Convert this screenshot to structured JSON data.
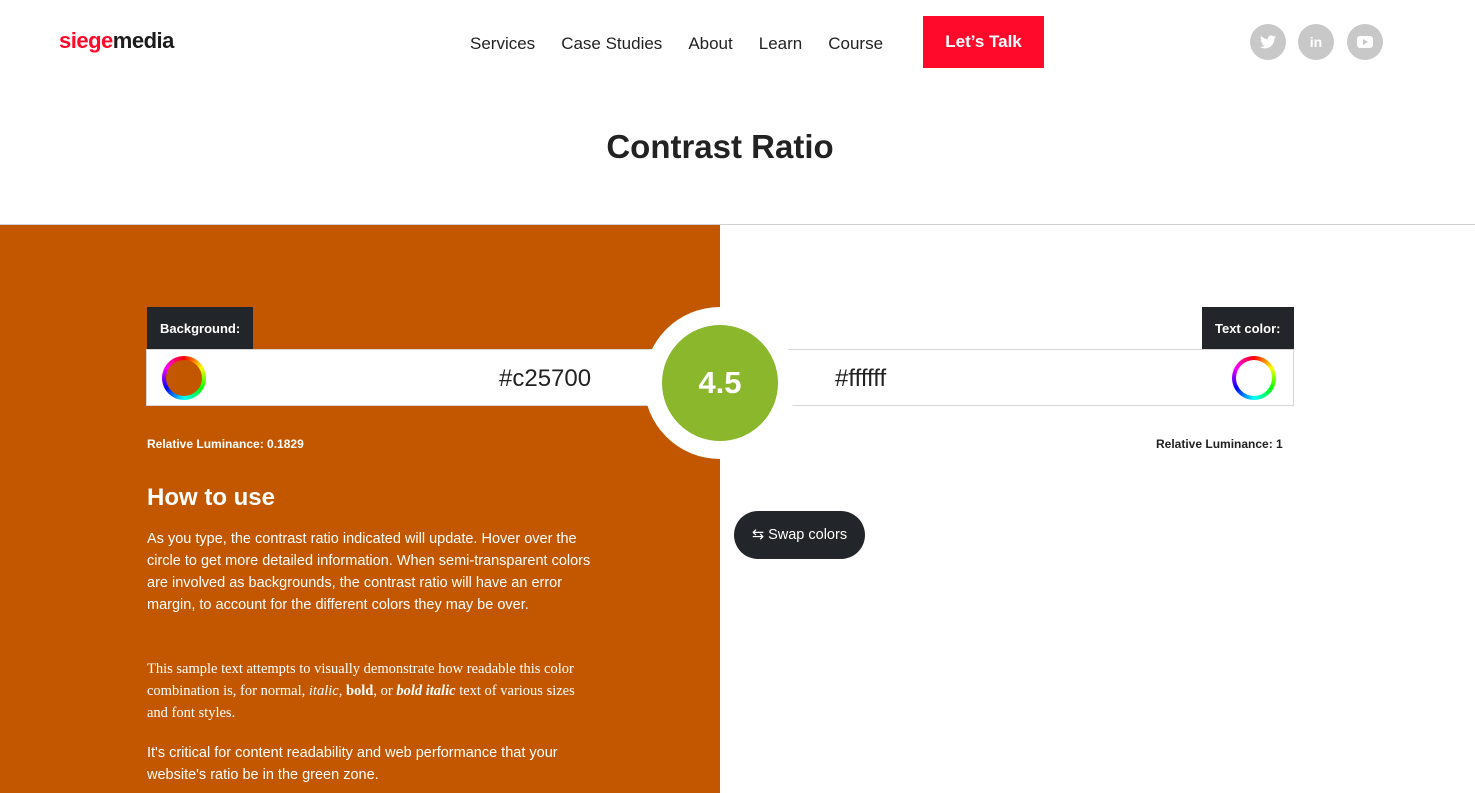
{
  "header": {
    "logo_part1": "siege",
    "logo_part2": "media",
    "nav": [
      "Services",
      "Case Studies",
      "About",
      "Learn",
      "Course"
    ],
    "cta_label": "Let’s Talk",
    "social": {
      "twitter_glyph": "🐦",
      "linkedin_glyph": "in",
      "youtube_glyph": "▶"
    }
  },
  "page_title": "Contrast Ratio",
  "colors": {
    "background_hex": "#c25700",
    "text_hex": "#ffffff",
    "ratio_badge": "#8ab72c",
    "brand_red": "#ff0a2a",
    "dark": "#222529"
  },
  "background": {
    "label": "Background:",
    "value": "#c25700",
    "luminance": "Relative Luminance: 0.1829"
  },
  "text_color": {
    "label": "Text color:",
    "value": "#ffffff",
    "luminance": "Relative Luminance: 1"
  },
  "ratio": "4.5",
  "swap_label": "⇆ Swap colors",
  "how_to_use": {
    "title": "How to use",
    "p1": "As you type, the contrast ratio indicated will update. Hover over the circle to get more detailed information. When semi-transparent colors are involved as backgrounds, the contrast ratio will have an error margin, to account for the different colors they may be over.",
    "p2_start": "This sample text attempts to visually demonstrate how readable this color combination is, for normal, ",
    "p2_italic": "italic",
    "p2_sep1": ", ",
    "p2_bold": "bold",
    "p2_sep2": ", or ",
    "p2_bold_italic": "bold italic",
    "p2_end": " text of various sizes and font styles.",
    "p3": "It's critical for content readability and web performance that your website's ratio be in the green zone."
  }
}
